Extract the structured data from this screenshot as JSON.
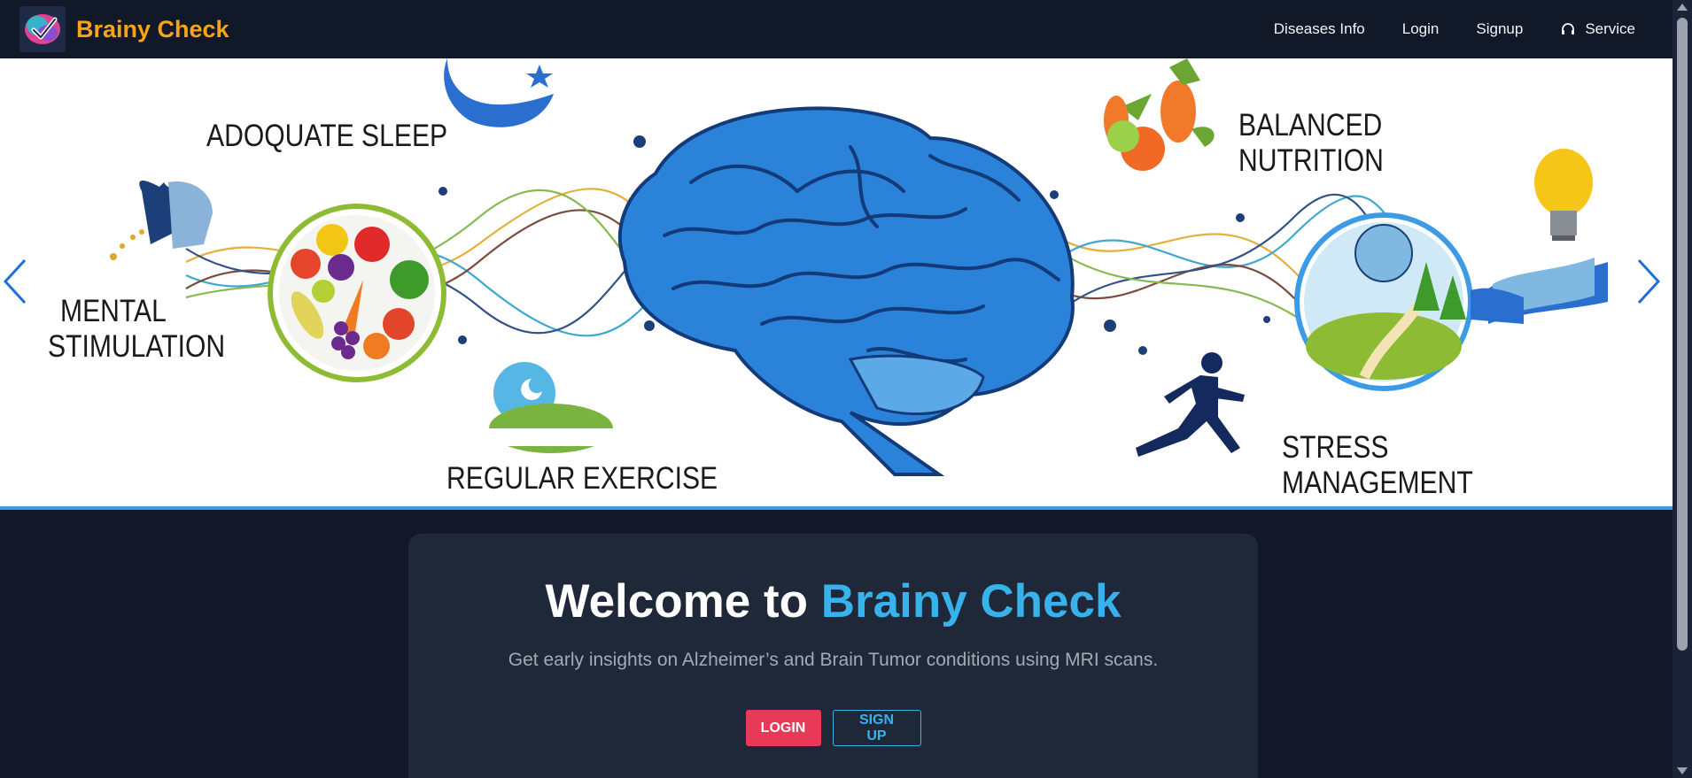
{
  "navbar": {
    "brand": "Brainy Check",
    "links": [
      {
        "label": "Diseases Info"
      },
      {
        "label": "Login"
      },
      {
        "label": "Signup"
      },
      {
        "label": "Service",
        "icon": "headset-icon"
      }
    ]
  },
  "hero": {
    "labels": {
      "sleep": "ADOQUATE SLEEP",
      "mental_1": "MENTAL",
      "mental_2": "STIMULATION",
      "exercise": "REGULAR EXERCISE",
      "nutrition_1": "BALANCED",
      "nutrition_2": "NUTRITION",
      "stress_1": "STRESS",
      "stress_2": "MANAGEMENT"
    },
    "prev_icon": "chevron-left-icon",
    "next_icon": "chevron-right-icon"
  },
  "welcome": {
    "title_prefix": "Welcome to ",
    "title_accent": "Brainy Check",
    "subtitle": "Get early insights on Alzheimer’s and Brain Tumor conditions using MRI scans.",
    "login_label": "LOGIN",
    "signup_label": "SIGN UP"
  },
  "colors": {
    "brand": "#f7a41a",
    "accent": "#38b2ea",
    "login_button": "#e83a58",
    "background": "#121829",
    "card": "#1f2839"
  }
}
